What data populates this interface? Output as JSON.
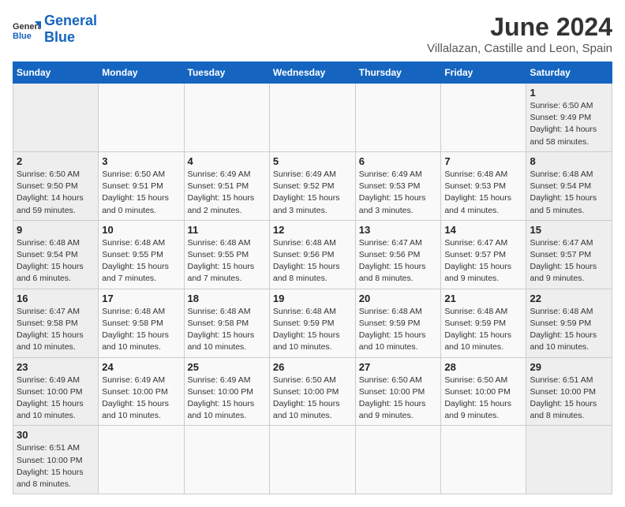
{
  "header": {
    "logo_general": "General",
    "logo_blue": "Blue",
    "title": "June 2024",
    "location": "Villalazan, Castille and Leon, Spain"
  },
  "days_of_week": [
    "Sunday",
    "Monday",
    "Tuesday",
    "Wednesday",
    "Thursday",
    "Friday",
    "Saturday"
  ],
  "weeks": [
    [
      {
        "day": "",
        "info": ""
      },
      {
        "day": "",
        "info": ""
      },
      {
        "day": "",
        "info": ""
      },
      {
        "day": "",
        "info": ""
      },
      {
        "day": "",
        "info": ""
      },
      {
        "day": "",
        "info": ""
      },
      {
        "day": "1",
        "info": "Sunrise: 6:50 AM\nSunset: 9:49 PM\nDaylight: 14 hours and 58 minutes."
      }
    ],
    [
      {
        "day": "2",
        "info": "Sunrise: 6:50 AM\nSunset: 9:50 PM\nDaylight: 14 hours and 59 minutes."
      },
      {
        "day": "3",
        "info": "Sunrise: 6:50 AM\nSunset: 9:51 PM\nDaylight: 15 hours and 0 minutes."
      },
      {
        "day": "4",
        "info": "Sunrise: 6:49 AM\nSunset: 9:51 PM\nDaylight: 15 hours and 2 minutes."
      },
      {
        "day": "5",
        "info": "Sunrise: 6:49 AM\nSunset: 9:52 PM\nDaylight: 15 hours and 3 minutes."
      },
      {
        "day": "6",
        "info": "Sunrise: 6:49 AM\nSunset: 9:53 PM\nDaylight: 15 hours and 3 minutes."
      },
      {
        "day": "7",
        "info": "Sunrise: 6:48 AM\nSunset: 9:53 PM\nDaylight: 15 hours and 4 minutes."
      },
      {
        "day": "8",
        "info": "Sunrise: 6:48 AM\nSunset: 9:54 PM\nDaylight: 15 hours and 5 minutes."
      }
    ],
    [
      {
        "day": "9",
        "info": "Sunrise: 6:48 AM\nSunset: 9:54 PM\nDaylight: 15 hours and 6 minutes."
      },
      {
        "day": "10",
        "info": "Sunrise: 6:48 AM\nSunset: 9:55 PM\nDaylight: 15 hours and 7 minutes."
      },
      {
        "day": "11",
        "info": "Sunrise: 6:48 AM\nSunset: 9:55 PM\nDaylight: 15 hours and 7 minutes."
      },
      {
        "day": "12",
        "info": "Sunrise: 6:48 AM\nSunset: 9:56 PM\nDaylight: 15 hours and 8 minutes."
      },
      {
        "day": "13",
        "info": "Sunrise: 6:47 AM\nSunset: 9:56 PM\nDaylight: 15 hours and 8 minutes."
      },
      {
        "day": "14",
        "info": "Sunrise: 6:47 AM\nSunset: 9:57 PM\nDaylight: 15 hours and 9 minutes."
      },
      {
        "day": "15",
        "info": "Sunrise: 6:47 AM\nSunset: 9:57 PM\nDaylight: 15 hours and 9 minutes."
      }
    ],
    [
      {
        "day": "16",
        "info": "Sunrise: 6:47 AM\nSunset: 9:58 PM\nDaylight: 15 hours and 10 minutes."
      },
      {
        "day": "17",
        "info": "Sunrise: 6:48 AM\nSunset: 9:58 PM\nDaylight: 15 hours and 10 minutes."
      },
      {
        "day": "18",
        "info": "Sunrise: 6:48 AM\nSunset: 9:58 PM\nDaylight: 15 hours and 10 minutes."
      },
      {
        "day": "19",
        "info": "Sunrise: 6:48 AM\nSunset: 9:59 PM\nDaylight: 15 hours and 10 minutes."
      },
      {
        "day": "20",
        "info": "Sunrise: 6:48 AM\nSunset: 9:59 PM\nDaylight: 15 hours and 10 minutes."
      },
      {
        "day": "21",
        "info": "Sunrise: 6:48 AM\nSunset: 9:59 PM\nDaylight: 15 hours and 10 minutes."
      },
      {
        "day": "22",
        "info": "Sunrise: 6:48 AM\nSunset: 9:59 PM\nDaylight: 15 hours and 10 minutes."
      }
    ],
    [
      {
        "day": "23",
        "info": "Sunrise: 6:49 AM\nSunset: 10:00 PM\nDaylight: 15 hours and 10 minutes."
      },
      {
        "day": "24",
        "info": "Sunrise: 6:49 AM\nSunset: 10:00 PM\nDaylight: 15 hours and 10 minutes."
      },
      {
        "day": "25",
        "info": "Sunrise: 6:49 AM\nSunset: 10:00 PM\nDaylight: 15 hours and 10 minutes."
      },
      {
        "day": "26",
        "info": "Sunrise: 6:50 AM\nSunset: 10:00 PM\nDaylight: 15 hours and 10 minutes."
      },
      {
        "day": "27",
        "info": "Sunrise: 6:50 AM\nSunset: 10:00 PM\nDaylight: 15 hours and 9 minutes."
      },
      {
        "day": "28",
        "info": "Sunrise: 6:50 AM\nSunset: 10:00 PM\nDaylight: 15 hours and 9 minutes."
      },
      {
        "day": "29",
        "info": "Sunrise: 6:51 AM\nSunset: 10:00 PM\nDaylight: 15 hours and 8 minutes."
      }
    ],
    [
      {
        "day": "30",
        "info": "Sunrise: 6:51 AM\nSunset: 10:00 PM\nDaylight: 15 hours and 8 minutes."
      },
      {
        "day": "",
        "info": ""
      },
      {
        "day": "",
        "info": ""
      },
      {
        "day": "",
        "info": ""
      },
      {
        "day": "",
        "info": ""
      },
      {
        "day": "",
        "info": ""
      },
      {
        "day": "",
        "info": ""
      }
    ]
  ]
}
